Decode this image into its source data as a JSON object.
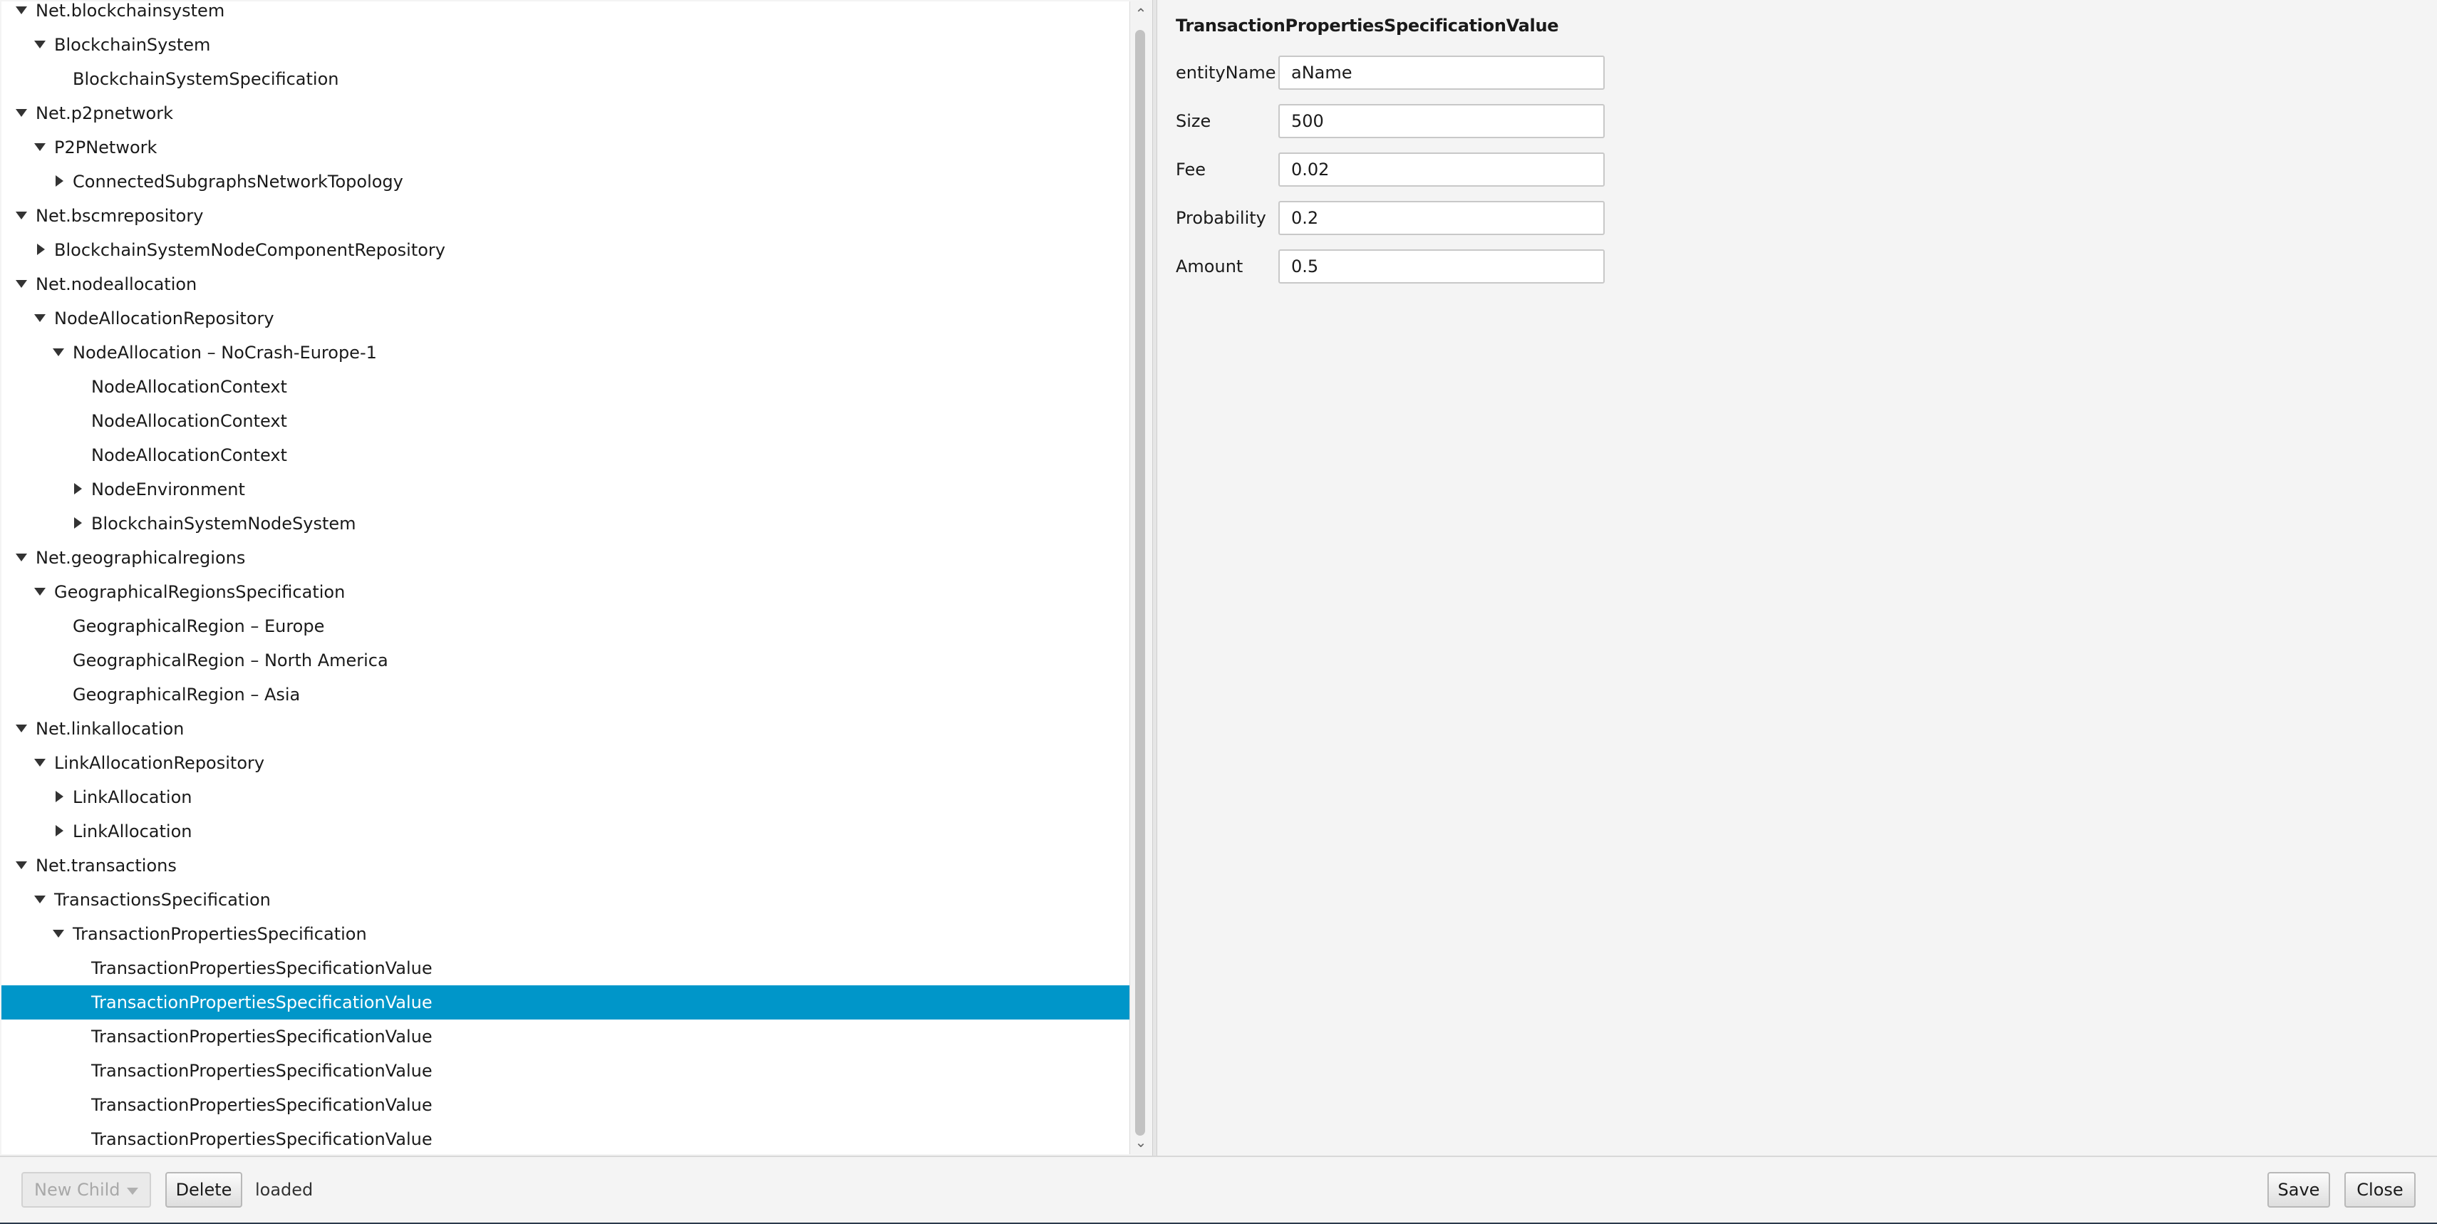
{
  "tree": {
    "selected_index": 29,
    "rows": [
      {
        "label": "Net.blockchainsystem",
        "level": 0,
        "toggle": "open"
      },
      {
        "label": "BlockchainSystem",
        "level": 1,
        "toggle": "open"
      },
      {
        "label": "BlockchainSystemSpecification",
        "level": 2,
        "toggle": "none"
      },
      {
        "label": "Net.p2pnetwork",
        "level": 0,
        "toggle": "open"
      },
      {
        "label": "P2PNetwork",
        "level": 1,
        "toggle": "open"
      },
      {
        "label": "ConnectedSubgraphsNetworkTopology",
        "level": 2,
        "toggle": "closed"
      },
      {
        "label": "Net.bscmrepository",
        "level": 0,
        "toggle": "open"
      },
      {
        "label": "BlockchainSystemNodeComponentRepository",
        "level": 1,
        "toggle": "closed"
      },
      {
        "label": "Net.nodeallocation",
        "level": 0,
        "toggle": "open"
      },
      {
        "label": "NodeAllocationRepository",
        "level": 1,
        "toggle": "open"
      },
      {
        "label": "NodeAllocation – NoCrash-Europe-1",
        "level": 2,
        "toggle": "open"
      },
      {
        "label": "NodeAllocationContext",
        "level": 3,
        "toggle": "none"
      },
      {
        "label": "NodeAllocationContext",
        "level": 3,
        "toggle": "none"
      },
      {
        "label": "NodeAllocationContext",
        "level": 3,
        "toggle": "none"
      },
      {
        "label": "NodeEnvironment",
        "level": 3,
        "toggle": "closed"
      },
      {
        "label": "BlockchainSystemNodeSystem",
        "level": 3,
        "toggle": "closed"
      },
      {
        "label": "Net.geographicalregions",
        "level": 0,
        "toggle": "open"
      },
      {
        "label": "GeographicalRegionsSpecification",
        "level": 1,
        "toggle": "open"
      },
      {
        "label": "GeographicalRegion – Europe",
        "level": 2,
        "toggle": "none"
      },
      {
        "label": "GeographicalRegion – North America",
        "level": 2,
        "toggle": "none"
      },
      {
        "label": "GeographicalRegion – Asia",
        "level": 2,
        "toggle": "none"
      },
      {
        "label": "Net.linkallocation",
        "level": 0,
        "toggle": "open"
      },
      {
        "label": "LinkAllocationRepository",
        "level": 1,
        "toggle": "open"
      },
      {
        "label": "LinkAllocation",
        "level": 2,
        "toggle": "closed"
      },
      {
        "label": "LinkAllocation",
        "level": 2,
        "toggle": "closed"
      },
      {
        "label": "Net.transactions",
        "level": 0,
        "toggle": "open"
      },
      {
        "label": "TransactionsSpecification",
        "level": 1,
        "toggle": "open"
      },
      {
        "label": "TransactionPropertiesSpecification",
        "level": 2,
        "toggle": "open"
      },
      {
        "label": "TransactionPropertiesSpecificationValue",
        "level": 3,
        "toggle": "none"
      },
      {
        "label": "TransactionPropertiesSpecificationValue",
        "level": 3,
        "toggle": "none"
      },
      {
        "label": "TransactionPropertiesSpecificationValue",
        "level": 3,
        "toggle": "none"
      },
      {
        "label": "TransactionPropertiesSpecificationValue",
        "level": 3,
        "toggle": "none"
      },
      {
        "label": "TransactionPropertiesSpecificationValue",
        "level": 3,
        "toggle": "none"
      },
      {
        "label": "TransactionPropertiesSpecificationValue",
        "level": 3,
        "toggle": "none"
      }
    ]
  },
  "detail": {
    "title": "TransactionPropertiesSpecificationValue",
    "fields": [
      {
        "label": "entityName",
        "value": "aName"
      },
      {
        "label": "Size",
        "value": "500"
      },
      {
        "label": "Fee",
        "value": "0.02"
      },
      {
        "label": "Probability",
        "value": "0.2"
      },
      {
        "label": "Amount",
        "value": "0.5"
      }
    ]
  },
  "toolbar": {
    "new_child_label": "New Child",
    "delete_label": "Delete",
    "status": "loaded",
    "save_label": "Save",
    "close_label": "Close"
  },
  "colors": {
    "selection": "#0096c9",
    "window_background": "#f4f4f4"
  }
}
